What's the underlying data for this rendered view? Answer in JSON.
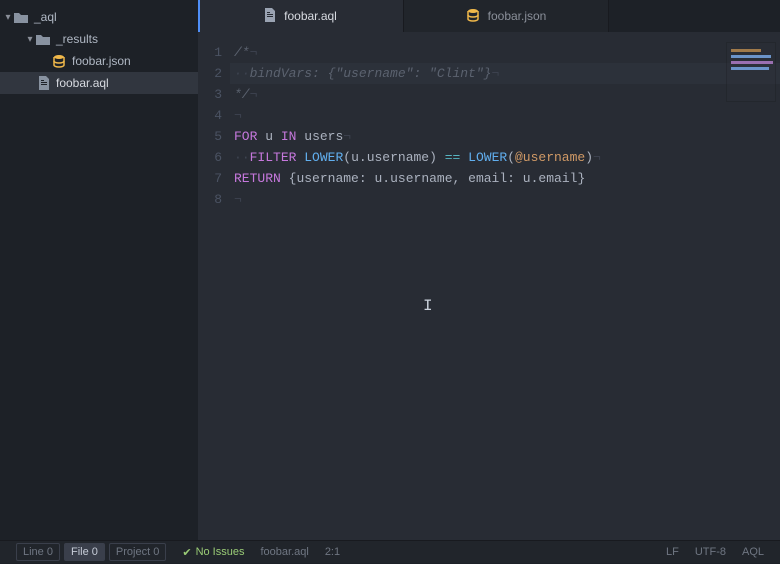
{
  "sidebar": {
    "items": [
      {
        "label": "_aql",
        "type": "folder",
        "indent": 0,
        "expanded": true
      },
      {
        "label": "_results",
        "type": "folder",
        "indent": 1,
        "expanded": true
      },
      {
        "label": "foobar.json",
        "type": "db",
        "indent": 2
      },
      {
        "label": "foobar.aql",
        "type": "file",
        "indent": 2,
        "selected": true
      }
    ]
  },
  "tabs": [
    {
      "label": "foobar.aql",
      "icon": "file",
      "active": true
    },
    {
      "label": "foobar.json",
      "icon": "db",
      "active": false
    }
  ],
  "editor": {
    "lines": [
      {
        "n": 1,
        "t": "/*",
        "cls": "comment"
      },
      {
        "n": 2,
        "t": "  bindVars: {\"username\": \"Clint\"}",
        "cls": "comment",
        "hl": true
      },
      {
        "n": 3,
        "t": "*/",
        "cls": "comment"
      },
      {
        "n": 4,
        "t": "",
        "cls": "blank"
      },
      {
        "n": 5,
        "t": "FOR u IN users",
        "cls": "for"
      },
      {
        "n": 6,
        "t": "  FILTER LOWER(u.username) == LOWER(@username)",
        "cls": "filter"
      },
      {
        "n": 7,
        "t": "RETURN {username: u.username, email: u.email}",
        "cls": "return"
      },
      {
        "n": 8,
        "t": "",
        "cls": "blank"
      }
    ]
  },
  "status": {
    "line_label": "Line",
    "line_value": "0",
    "file_label": "File",
    "file_value": "0",
    "project_label": "Project",
    "project_value": "0",
    "issues": "No Issues",
    "filename": "foobar.aql",
    "cursor": "2:1",
    "line_ending": "LF",
    "encoding": "UTF-8",
    "language": "AQL"
  }
}
